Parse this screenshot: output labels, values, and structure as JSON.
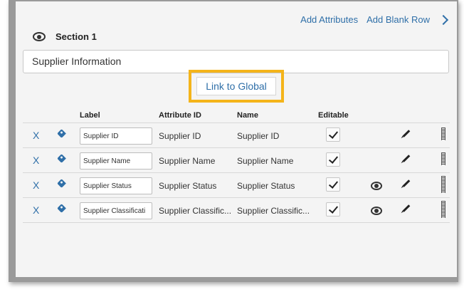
{
  "toolbar": {
    "add_attributes": "Add Attributes",
    "add_blank_row": "Add Blank Row",
    "next_icon": "chevron-right-icon"
  },
  "section": {
    "title": "Section 1",
    "name_value": "Supplier Information",
    "link_global": "Link to Global"
  },
  "table": {
    "headers": {
      "label": "Label",
      "attribute_id": "Attribute ID",
      "name": "Name",
      "editable": "Editable"
    },
    "rows": [
      {
        "remove": "X",
        "label": "Supplier ID",
        "attribute_id": "Supplier ID",
        "name": "Supplier ID",
        "editable": true,
        "visible_icon": false
      },
      {
        "remove": "X",
        "label": "Supplier Name",
        "attribute_id": "Supplier Name",
        "name": "Supplier Name",
        "editable": true,
        "visible_icon": false
      },
      {
        "remove": "X",
        "label": "Supplier Status",
        "attribute_id": "Supplier Status",
        "name": "Supplier Status",
        "editable": true,
        "visible_icon": true
      },
      {
        "remove": "X",
        "label": "Supplier Classificati",
        "attribute_id": "Supplier Classific...",
        "name": "Supplier Classific...",
        "editable": true,
        "visible_icon": true
      }
    ]
  },
  "colors": {
    "link": "#2f6fa8",
    "highlight": "#f4b41a",
    "panel": "#f4f4f4"
  }
}
